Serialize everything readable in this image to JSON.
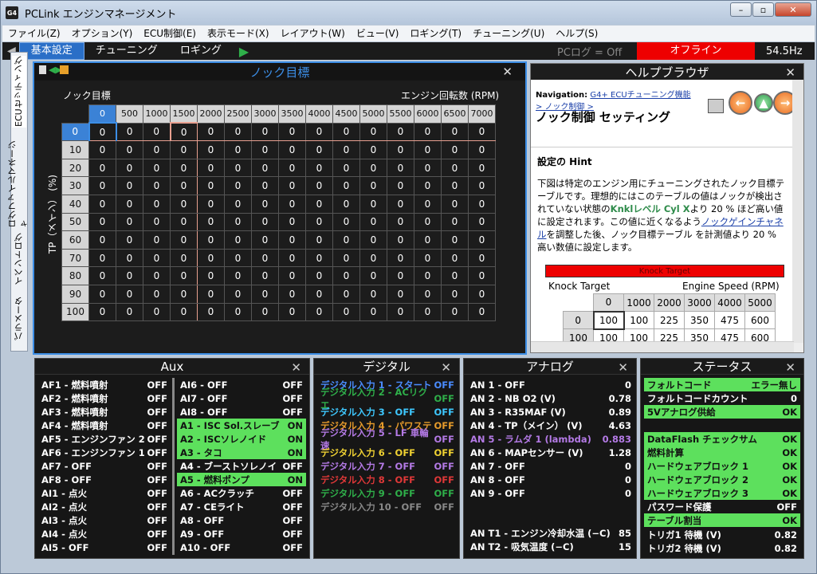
{
  "window": {
    "title": "PCLink エンジンマネージメント",
    "app_icon": "G4"
  },
  "menu": [
    "ファイル(Z)",
    "オプション(Y)",
    "ECU制御(E)",
    "表示モード(X)",
    "レイアウト(W)",
    "ビュー(V)",
    "ロギング(T)",
    "チューニング(U)",
    "ヘルプ(S)"
  ],
  "toolbar": {
    "tabs": [
      "基本設定",
      "チューニング",
      "ロギング"
    ],
    "pclog": "PCログ = Off",
    "status": "オフライン",
    "rate": "54.5Hz"
  },
  "sidebar": [
    "ECUセッティング",
    "ログファイルマネージャ",
    "イベントログ",
    "パラメータ"
  ],
  "knock": {
    "title": "ノック目標",
    "corner": "ノック目標",
    "xlabel": "エンジン回転数 (RPM)",
    "ylabel": "TP（メイン） (%)",
    "cols": [
      "0",
      "500",
      "1000",
      "1500",
      "2000",
      "2500",
      "3000",
      "3500",
      "4000",
      "4500",
      "5000",
      "5500",
      "6000",
      "6500",
      "7000"
    ],
    "rows": [
      "0",
      "10",
      "20",
      "30",
      "40",
      "50",
      "60",
      "70",
      "80",
      "90",
      "100"
    ],
    "cell": "0"
  },
  "help": {
    "title": "ヘルプブラウザ",
    "nav_label": "Navigation:",
    "nav_link": "G4+ ECUチューニング機能",
    "nav_sub": "> ノック制御 >",
    "heading": "ノック制御 セッティング",
    "hint": "設定の Hint",
    "body1": "下図は特定のエンジン用にチューニングされたノック目標テーブルです。理想的にはこのテーブルの値はノックが検出されていない状態の",
    "knkl": "Knklレベル Cyl X",
    "body2": "より 20 % ほど高い値に設定されます。この値に近くなるよう",
    "link2": "ノックゲインチャネル",
    "body3": "を調整した後、ノック目標テーブル を計測値より 20 % 高い数値に設定します。",
    "embed_title": "Knock Target",
    "embed_corner": "Knock Target",
    "embed_xlabel": "Engine Speed (RPM)",
    "embed_cols": [
      "0",
      "1000",
      "2000",
      "3000",
      "4000",
      "5000"
    ],
    "embed_row_labels": [
      "0",
      "100"
    ],
    "embed_rows": [
      [
        "100",
        "100",
        "225",
        "350",
        "475",
        "600"
      ],
      [
        "100",
        "100",
        "225",
        "350",
        "475",
        "600"
      ]
    ]
  },
  "aux": {
    "title": "Aux",
    "col1": [
      [
        "AF1 - 燃料噴射",
        "OFF"
      ],
      [
        "AF2 - 燃料噴射",
        "OFF"
      ],
      [
        "AF3 - 燃料噴射",
        "OFF"
      ],
      [
        "AF4 - 燃料噴射",
        "OFF"
      ],
      [
        "AF5 - エンジンファン 2",
        "OFF"
      ],
      [
        "AF6 - エンジンファン 1",
        "OFF"
      ],
      [
        "AF7 - OFF",
        "OFF"
      ],
      [
        "AF8 - OFF",
        "OFF"
      ],
      [
        "AI1 - 点火",
        "OFF"
      ],
      [
        "AI2 - 点火",
        "OFF"
      ],
      [
        "AI3 - 点火",
        "OFF"
      ],
      [
        "AI4 - 点火",
        "OFF"
      ],
      [
        "AI5 - OFF",
        "OFF"
      ]
    ],
    "col2": [
      [
        "AI6 - OFF",
        "OFF"
      ],
      [
        "AI7 - OFF",
        "OFF"
      ],
      [
        "AI8 - OFF",
        "OFF"
      ],
      [
        "A1 - ISC Sol.スレーブ",
        "ON"
      ],
      [
        "A2 - ISCソレノイド",
        "ON"
      ],
      [
        "A3 - タコ",
        "ON"
      ],
      [
        "A4 - ブーストソレノイ",
        "OFF"
      ],
      [
        "A5 - 燃料ポンプ",
        "ON"
      ],
      [
        "A6 - ACクラッチ",
        "OFF"
      ],
      [
        "A7 - CEライト",
        "OFF"
      ],
      [
        "A8 - OFF",
        "OFF"
      ],
      [
        "A9 - OFF",
        "OFF"
      ],
      [
        "A10 - OFF",
        "OFF"
      ]
    ]
  },
  "digital": {
    "title": "デジタル",
    "items": [
      [
        "デジタル入力 1 - スタート",
        "OFF",
        "blue"
      ],
      [
        "デジタル入力 2 - ACリクエ",
        "OFF",
        "green"
      ],
      [
        "デジタル入力 3 - OFF",
        "OFF",
        "cyan"
      ],
      [
        "デジタル入力 4 - パワステ",
        "OFF",
        "orange"
      ],
      [
        "デジタル入力 5 - LF 車輪速",
        "OFF",
        "purple"
      ],
      [
        "デジタル入力 6 - OFF",
        "OFF",
        "yellow"
      ],
      [
        "デジタル入力 7 - OFF",
        "OFF",
        "purple"
      ],
      [
        "デジタル入力 8 - OFF",
        "OFF",
        "red"
      ],
      [
        "デジタル入力 9 - OFF",
        "OFF",
        "green"
      ],
      [
        "デジタル入力 10 - OFF",
        "OFF",
        "gray"
      ]
    ]
  },
  "analog": {
    "title": "アナログ",
    "items": [
      [
        "AN 1 - OFF",
        "0"
      ],
      [
        "AN 2 - NB O2 (V)",
        "0.78"
      ],
      [
        "AN 3 - R35MAF (V)",
        "0.89"
      ],
      [
        "AN 4 - TP（メイン） (V)",
        "4.63"
      ],
      [
        "AN 5 - ラムダ 1 (lambda)",
        "0.883"
      ],
      [
        "AN 6 - MAPセンサー (V)",
        "1.28"
      ],
      [
        "AN 7 - OFF",
        "0"
      ],
      [
        "AN 8 - OFF",
        "0"
      ],
      [
        "AN 9 - OFF",
        "0"
      ]
    ],
    "t_items": [
      [
        "AN T1 - エンジン冷却水温 (−C)",
        "85"
      ],
      [
        "AN T2 - 吸気温度 (−C)",
        "15"
      ]
    ]
  },
  "status": {
    "title": "ステータス",
    "items": [
      [
        "フォルトコード",
        "エラー無し",
        true
      ],
      [
        "フォルトコードカウント",
        "0",
        false
      ],
      [
        "5Vアナログ供給",
        "OK",
        true
      ],
      [
        "DataFlash チェックサム",
        "OK",
        true
      ],
      [
        "燃料計算",
        "OK",
        true
      ],
      [
        "ハードウェアブロック 1",
        "OK",
        true
      ],
      [
        "ハードウェアブロック 2",
        "OK",
        true
      ],
      [
        "ハードウェアブロック 3",
        "OK",
        true
      ],
      [
        "パスワード保護",
        "OFF",
        false
      ],
      [
        "テーブル割当",
        "OK",
        true
      ],
      [
        "トリガ1 待機 (V)",
        "0.82",
        false
      ],
      [
        "トリガ2 待機 (V)",
        "0.82",
        false
      ]
    ]
  },
  "colors": {
    "accent": "#3c8ee6",
    "on": "#5de05d",
    "offline": "#e00000"
  }
}
